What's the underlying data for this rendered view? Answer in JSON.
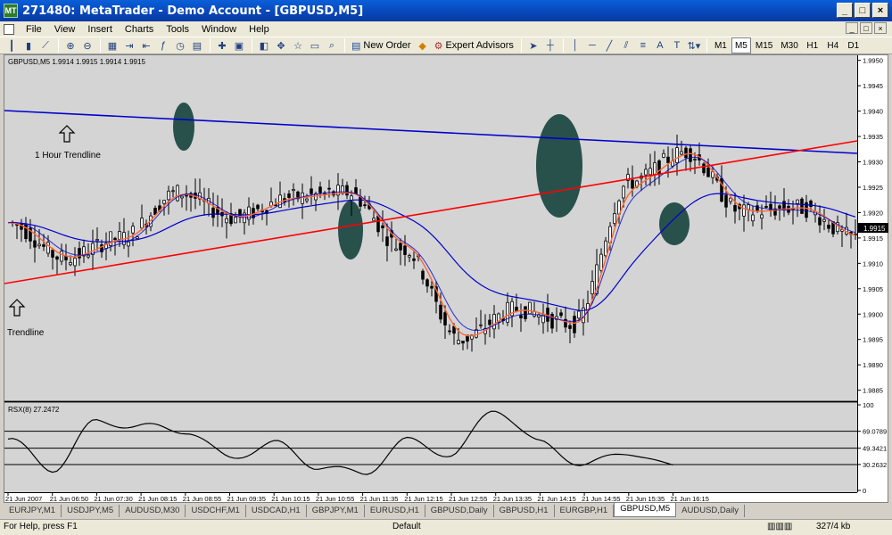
{
  "window": {
    "title": "271480: MetaTrader - Demo Account - [GBPUSD,M5]",
    "app_badge": "MT",
    "minimize": "_",
    "maximize": "□",
    "close": "×"
  },
  "menu": [
    "File",
    "View",
    "Insert",
    "Charts",
    "Tools",
    "Window",
    "Help"
  ],
  "toolbar": {
    "new_order": "New Order",
    "expert_advisors": "Expert Advisors",
    "timeframes": [
      "M1",
      "M5",
      "M15",
      "M30",
      "H1",
      "H4",
      "D1"
    ],
    "active_timeframe": "M5"
  },
  "chart": {
    "header": "GBPUSD,M5  1.9914 1.9915 1.9914 1.9915",
    "current_price": "1.9915",
    "price_ticks": [
      "1.9950",
      "1.9945",
      "1.9940",
      "1.9935",
      "1.9930",
      "1.9925",
      "1.9920",
      "1.9915",
      "1.9910",
      "1.9905",
      "1.9900",
      "1.9895",
      "1.9890",
      "1.9885"
    ],
    "time_ticks": [
      "21 Jun 2007",
      "21 Jun 06:50",
      "21 Jun 07:30",
      "21 Jun 08:15",
      "21 Jun 08:55",
      "21 Jun 09:35",
      "21 Jun 10:15",
      "21 Jun 10:55",
      "21 Jun 11:35",
      "21 Jun 12:15",
      "21 Jun 12:55",
      "21 Jun 13:35",
      "21 Jun 14:15",
      "21 Jun 14:55",
      "21 Jun 15:35",
      "21 Jun 16:15"
    ],
    "annotation_1h": "1 Hour Trendline",
    "annotation_tl": "Trendline",
    "rsx_header": "RSX(8) 27.2472",
    "rsx_ticks": [
      "100",
      "69.0789",
      "49.3421",
      "30.2632",
      "0"
    ]
  },
  "chart_data": {
    "type": "line",
    "title": "",
    "series": [
      {
        "name": "GBPUSD,M5",
        "x": [
          "21 Jun 2007",
          "21 Jun 06:50",
          "21 Jun 07:30",
          "21 Jun 08:15",
          "21 Jun 08:55",
          "21 Jun 09:35",
          "21 Jun 10:15",
          "21 Jun 10:55",
          "21 Jun 11:35",
          "21 Jun 12:15",
          "21 Jun 12:55",
          "21 Jun 13:35",
          "21 Jun 14:15",
          "21 Jun 14:55",
          "21 Jun 15:35",
          "21 Jun 16:15"
        ],
        "y": [
          1.9918,
          1.9911,
          1.9915,
          1.9924,
          1.9919,
          1.9923,
          1.9924,
          1.9913,
          1.9895,
          1.9901,
          1.9898,
          1.9926,
          1.9932,
          1.992,
          1.9921,
          1.9915
        ]
      },
      {
        "name": "RSX(8)",
        "x": [
          "21 Jun 2007",
          "21 Jun 06:50",
          "21 Jun 07:30",
          "21 Jun 08:15",
          "21 Jun 08:55",
          "21 Jun 09:35",
          "21 Jun 10:15",
          "21 Jun 10:55",
          "21 Jun 11:35",
          "21 Jun 12:15",
          "21 Jun 12:55",
          "21 Jun 13:35",
          "21 Jun 14:15",
          "21 Jun 14:55",
          "21 Jun 15:35",
          "21 Jun 16:15"
        ],
        "y": [
          60,
          25,
          80,
          75,
          70,
          38,
          55,
          28,
          20,
          58,
          42,
          95,
          55,
          30,
          45,
          27
        ]
      }
    ],
    "ylim": [
      1.9883,
      1.9951
    ],
    "rsx_ylim": [
      0,
      100
    ],
    "rsx_levels": [
      69.0789,
      49.3421,
      30.2632
    ],
    "grid": false
  },
  "tabs": [
    "EURJPY,M1",
    "USDJPY,M5",
    "AUDUSD,M30",
    "USDCHF,M1",
    "USDCAD,H1",
    "GBPJPY,M1",
    "EURUSD,H1",
    "GBPUSD,Daily",
    "GBPUSD,H1",
    "EURGBP,H1",
    "GBPUSD,M5",
    "AUDUSD,Daily"
  ],
  "active_tab": "GBPUSD,M5",
  "status": {
    "help": "For Help, press F1",
    "profile": "Default",
    "traffic": "327/4 kb"
  },
  "colors": {
    "price_bg": "#d4d4d4",
    "blue_line": "#0000cc",
    "red_line": "#ff0000",
    "ma_fast": "#ff6633",
    "highlight": "#1f4a44"
  }
}
